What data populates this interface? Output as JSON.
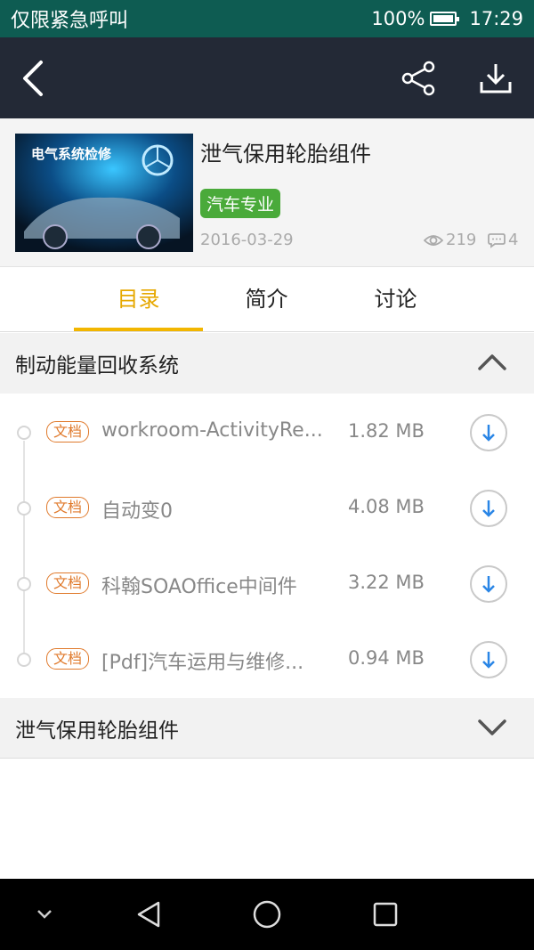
{
  "status_bar": {
    "carrier": "仅限紧急呼叫",
    "battery": "100%",
    "time": "17:29"
  },
  "app_bar": {
    "back_icon": "chevron-left-icon",
    "share_icon": "share-icon",
    "download_icon": "download-icon"
  },
  "course": {
    "thumbnail_text": "电气系统检修",
    "title": "泄气保用轮胎组件",
    "tag": "汽车专业",
    "tag_color": "#4aaa3a",
    "date": "2016-03-29",
    "views": "219",
    "comments": "4"
  },
  "tabs": [
    {
      "label": "目录",
      "active": true
    },
    {
      "label": "简介",
      "active": false
    },
    {
      "label": "讨论",
      "active": false
    }
  ],
  "accent_color": "#f2b600",
  "sections": [
    {
      "title": "制动能量回收系统",
      "expanded": true,
      "files": [
        {
          "badge": "文档",
          "name": "workroom-ActivityRe...",
          "size": "1.82 MB"
        },
        {
          "badge": "文档",
          "name": "自动变0",
          "size": "4.08 MB"
        },
        {
          "badge": "文档",
          "name": "科翰SOAOffice中间件",
          "size": "3.22 MB"
        },
        {
          "badge": "文档",
          "name": "[Pdf]汽车运用与维修...",
          "size": "0.94 MB"
        }
      ]
    },
    {
      "title": "泄气保用轮胎组件",
      "expanded": false,
      "files": []
    }
  ],
  "nav_bar": {
    "collapse_icon": "chevron-down-icon",
    "back_icon": "triangle-back-icon",
    "home_icon": "circle-home-icon",
    "recents_icon": "square-recents-icon"
  }
}
